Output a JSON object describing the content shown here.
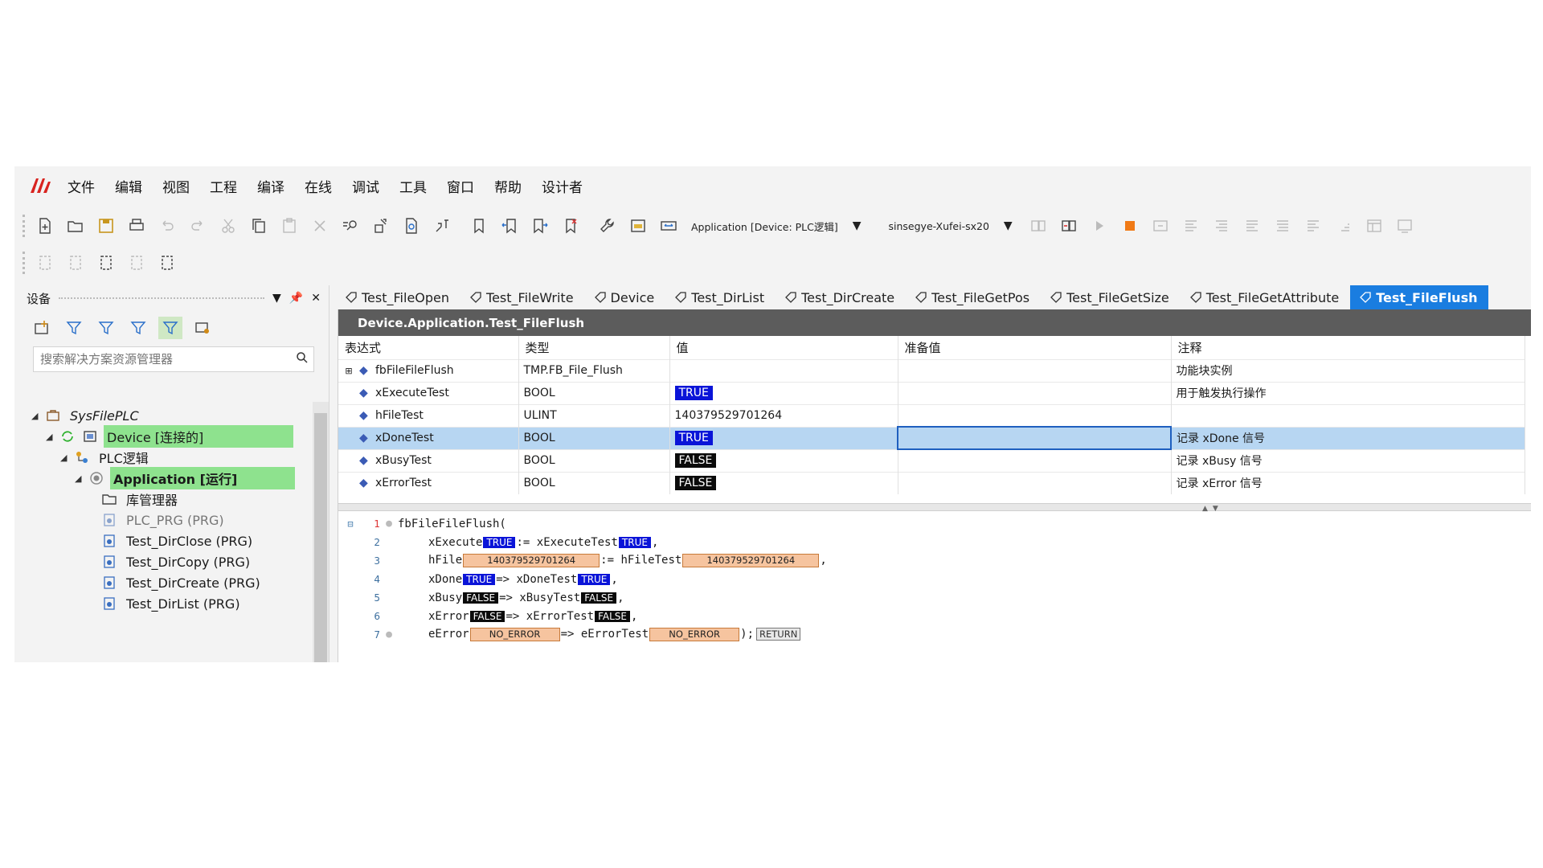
{
  "menu": {
    "items": [
      "文件",
      "编辑",
      "视图",
      "工程",
      "编译",
      "在线",
      "调试",
      "工具",
      "窗口",
      "帮助",
      "设计者"
    ]
  },
  "toolbar": {
    "application_dropdown": "Application [Device: PLC逻辑]",
    "gateway_dropdown": "sinsegye-Xufei-sx20"
  },
  "devices_panel": {
    "title": "设备",
    "search_placeholder": "搜索解决方案资源管理器",
    "tree": [
      {
        "label": "SysFilePLC",
        "icon": "project-icon",
        "italic": true
      },
      {
        "label": "Device [连接的]",
        "icon": "device-icon",
        "highlight": true
      },
      {
        "label": "PLC逻辑",
        "icon": "plc-logic-icon"
      },
      {
        "label": "Application [运行]",
        "icon": "application-icon",
        "highlight": true
      },
      {
        "label": "库管理器",
        "icon": "folder-icon"
      },
      {
        "label": "PLC_PRG (PRG)",
        "icon": "program-icon",
        "grey": true
      },
      {
        "label": "Test_DirClose (PRG)",
        "icon": "program-icon"
      },
      {
        "label": "Test_DirCopy (PRG)",
        "icon": "program-icon"
      },
      {
        "label": "Test_DirCreate (PRG)",
        "icon": "program-icon"
      },
      {
        "label": "Test_DirList (PRG)",
        "icon": "program-icon"
      }
    ]
  },
  "tabs": [
    {
      "label": "Test_FileOpen"
    },
    {
      "label": "Test_FileWrite"
    },
    {
      "label": "Device"
    },
    {
      "label": "Test_DirList"
    },
    {
      "label": "Test_DirCreate"
    },
    {
      "label": "Test_FileGetPos"
    },
    {
      "label": "Test_FileGetSize"
    },
    {
      "label": "Test_FileGetAttribute"
    },
    {
      "label": "Test_FileFlush",
      "active": true
    }
  ],
  "editor": {
    "title": "Device.Application.Test_FileFlush",
    "columns": [
      "表达式",
      "类型",
      "值",
      "准备值",
      "注释"
    ],
    "rows": [
      {
        "expr": "fbFileFileFlush",
        "type": "TMP.FB_File_Flush",
        "value": "",
        "prepared": "",
        "comment": "功能块实例"
      },
      {
        "expr": "xExecuteTest",
        "type": "BOOL",
        "value": "TRUE",
        "prepared": "",
        "comment": "用于触发执行操作"
      },
      {
        "expr": "hFileTest",
        "type": "ULINT",
        "value": "140379529701264",
        "prepared": "",
        "comment": ""
      },
      {
        "expr": "xDoneTest",
        "type": "BOOL",
        "value": "TRUE",
        "prepared": "",
        "comment": "记录 xDone 信号"
      },
      {
        "expr": "xBusyTest",
        "type": "BOOL",
        "value": "FALSE",
        "prepared": "",
        "comment": "记录 xBusy 信号"
      },
      {
        "expr": "xErrorTest",
        "type": "BOOL",
        "value": "FALSE",
        "prepared": "",
        "comment": "记录 xError 信号"
      }
    ],
    "code": {
      "line1": "fbFileFileFlush(",
      "l2_a": "xExecute",
      "l2_b": ":= xExecuteTest",
      "l2_c": ",",
      "l3_a": "hFile",
      "l3_b": ":= hFileTest",
      "l3_c": ",",
      "l4_a": "xDone",
      "l4_b": "=> xDoneTest",
      "l4_c": ",",
      "l5_a": "xBusy",
      "l5_b": "=> xBusyTest",
      "l5_c": ",",
      "l6_a": "xError",
      "l6_b": "=> xErrorTest",
      "l6_c": ",",
      "l7_a": "eError",
      "l7_b": "=> eErrorTest",
      "l7_c": ");",
      "val_true": "TRUE",
      "val_false": "FALSE",
      "val_handle": "140379529701264",
      "val_no_error": "NO_ERROR",
      "return_label": "RETURN",
      "line_numbers": [
        "1",
        "2",
        "3",
        "4",
        "5",
        "6",
        "7"
      ]
    }
  },
  "colors": {
    "active_tab": "#1a7de0",
    "true_bg": "#0a14d8",
    "false_bg": "#0b0b0b",
    "highlight_green": "#8ee28e",
    "selected_row": "#b7d6f2",
    "orange_monitor": "#f6c49f"
  }
}
